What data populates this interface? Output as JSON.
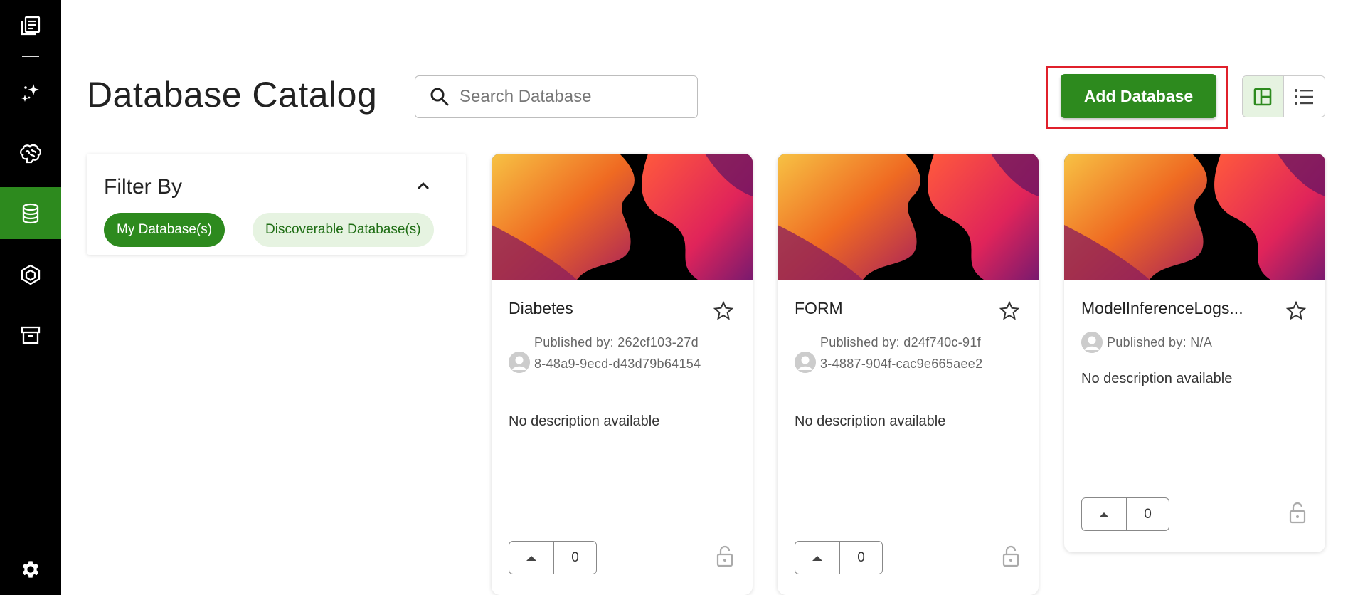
{
  "sidebar": {
    "items": [
      {
        "name": "catalog-icon"
      },
      {
        "name": "magic-icon"
      },
      {
        "name": "brain-icon"
      },
      {
        "name": "database-icon",
        "active": true
      },
      {
        "name": "model-cube-icon"
      },
      {
        "name": "archive-icon"
      },
      {
        "name": "settings-gear-icon"
      }
    ]
  },
  "header": {
    "title": "Database Catalog",
    "search_placeholder": "Search Database",
    "add_button_label": "Add Database"
  },
  "filter": {
    "title": "Filter By",
    "chips": [
      {
        "label": "My Database(s)",
        "active": true
      },
      {
        "label": "Discoverable Database(s)",
        "active": false
      }
    ]
  },
  "cards": [
    {
      "title": "Diabetes",
      "published_by": "Published by: 262cf103-27d8-48a9-9ecd-d43d79b64154",
      "description": "No description available",
      "votes": "0"
    },
    {
      "title": "FORM",
      "published_by": "Published by: d24f740c-91f3-4887-904f-cac9e665aee2",
      "description": "No description available",
      "votes": "0"
    },
    {
      "title": "ModelInferenceLogs...",
      "published_by": "Published by: N/A",
      "description": "No description available",
      "votes": "0"
    }
  ],
  "colors": {
    "accent": "#2d8a1e",
    "accent_light": "#e6f3e1",
    "highlight": "#e0202b",
    "sidebar_bg": "#000000"
  }
}
